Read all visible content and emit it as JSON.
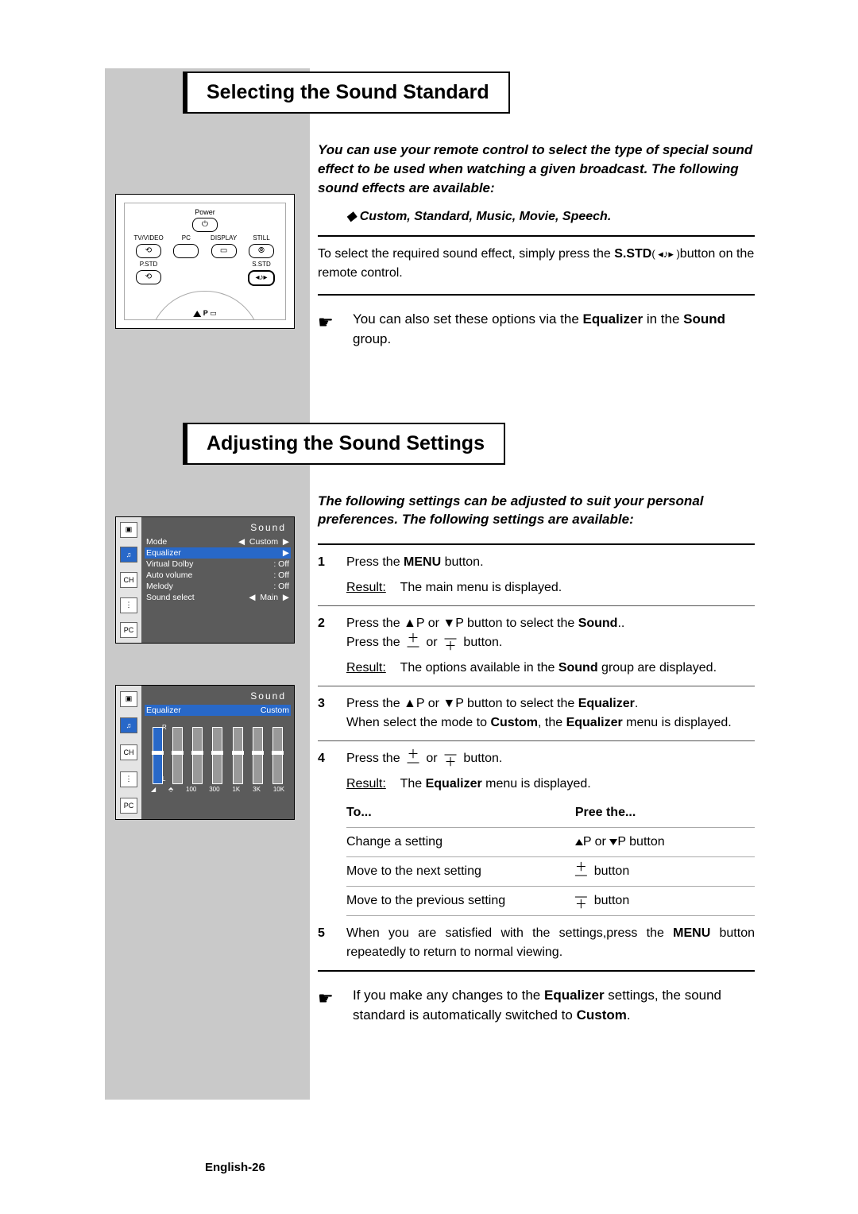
{
  "section1": {
    "title": "Selecting the Sound Standard",
    "intro": "You can use your remote control to select the type of special sound effect to be used when watching a given broadcast. The following sound effects are available:",
    "bullet": "◆  Custom, Standard, Music, Movie, Speech.",
    "body_pre": "To select the required sound effect, simply press the ",
    "body_btn": "S.STD",
    "body_icon": "( ◂♪▸ )",
    "body_post": "button on the remote control.",
    "note_pre": "You can also set these options via the ",
    "note_bold1": "Equalizer",
    "note_mid": " in the ",
    "note_bold2": "Sound",
    "note_post": " group."
  },
  "section2": {
    "title": "Adjusting the Sound Settings",
    "intro": "The following settings can be adjusted to suit your personal preferences. The following settings are available:",
    "steps": {
      "1": {
        "a": "Press the ",
        "b": "MENU",
        "c": " button.",
        "result": "The main menu is displayed."
      },
      "2": {
        "a": "Press the ▲P or ▼P button to select the ",
        "b": "Sound",
        "c": "..",
        "line2": "Press the  ＋  or  ＝  button.",
        "result_pre": "The options available in the ",
        "result_b": "Sound",
        "result_post": " group are displayed."
      },
      "3": {
        "a": "Press the ▲P or ▼P button to select the ",
        "b": "Equalizer",
        "c": ".",
        "line2_pre": "When select the mode to ",
        "line2_b1": "Custom",
        "line2_mid": ", the ",
        "line2_b2": "Equalizer",
        "line2_post": " menu is displayed."
      },
      "4": {
        "a": "Press the  ＋  or  ＝  button.",
        "result_pre": "The ",
        "result_b": "Equalizer",
        "result_post": "  menu is displayed."
      },
      "5": {
        "a": "When you are satisfied with the settings,press the ",
        "b": "MENU",
        "c": " button repeatedly to return to normal viewing."
      }
    },
    "table": {
      "h1": "To...",
      "h2": "Pree the...",
      "r1a": "Change a setting",
      "r1b": "▲P or ▼P button",
      "r2a": "Move to the next setting",
      "r2b": "＋  button",
      "r3a": "Move to the previous setting",
      "r3b": "＝  button"
    },
    "note_pre": "If you make any changes to the ",
    "note_b1": "Equalizer",
    "note_mid": " settings, the sound standard is automatically switched to ",
    "note_b2": "Custom",
    "note_post": "."
  },
  "remote": {
    "power": "Power",
    "labels": [
      "TV/VIDEO",
      "PC",
      "DISPLAY",
      "STILL"
    ],
    "pstd": "P.STD",
    "sstd": "S.STD",
    "p_icon": "P",
    "arrow_icon": "▲"
  },
  "osd1": {
    "title": "Sound",
    "rows": [
      {
        "l": "Mode",
        "m": "◀",
        "v": "Custom",
        "r": "▶",
        "hl": false
      },
      {
        "l": "Equalizer",
        "m": "",
        "v": "",
        "r": "▶",
        "hl": true
      },
      {
        "l": "Virtual Dolby",
        "m": "",
        "v": ":  Off",
        "r": "",
        "hl": false
      },
      {
        "l": "Auto volume",
        "m": "",
        "v": ":  Off",
        "r": "",
        "hl": false
      },
      {
        "l": "Melody",
        "m": "",
        "v": ":  Off",
        "r": "",
        "hl": false
      },
      {
        "l": "Sound select",
        "m": "◀",
        "v": "Main",
        "r": "▶",
        "hl": false
      }
    ],
    "side": [
      "▣",
      "♫",
      "CH",
      "⋮",
      "PC"
    ]
  },
  "osd2": {
    "title": "Sound",
    "header": {
      "l": "Equalizer",
      "v": "Custom"
    },
    "scale": {
      "top": "R",
      "bot": "L"
    },
    "freqs": [
      "◢",
      "⬘",
      "100",
      "300",
      "1K",
      "3K",
      "10K"
    ],
    "side": [
      "▣",
      "♫",
      "CH",
      "⋮",
      "PC"
    ]
  },
  "misc": {
    "result": "Result:",
    "hand": "☛",
    "diamond": "◆"
  },
  "footer": "English-26"
}
